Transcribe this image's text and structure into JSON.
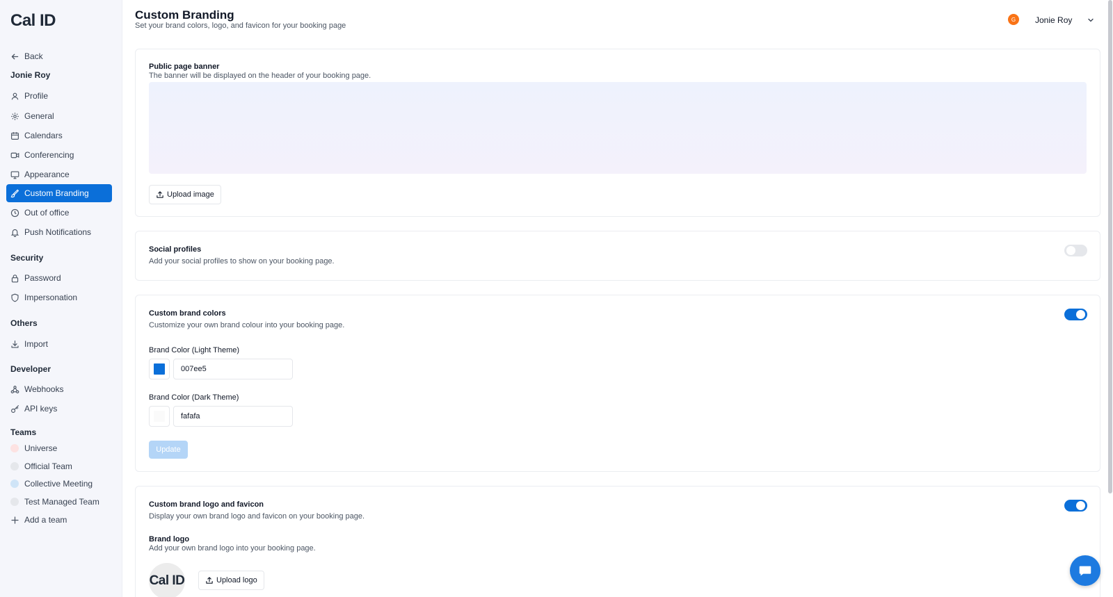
{
  "app": {
    "logo": "Cal ID"
  },
  "sidebar": {
    "back_label": "Back",
    "user_name": "Jonie Roy",
    "account_items": [
      {
        "label": "Profile",
        "icon": "user-icon"
      },
      {
        "label": "General",
        "icon": "gear-icon"
      },
      {
        "label": "Calendars",
        "icon": "calendar-icon"
      },
      {
        "label": "Conferencing",
        "icon": "video-icon"
      },
      {
        "label": "Appearance",
        "icon": "monitor-icon"
      },
      {
        "label": "Custom Branding",
        "icon": "brush-icon",
        "active": true
      },
      {
        "label": "Out of office",
        "icon": "clock-icon"
      },
      {
        "label": "Push Notifications",
        "icon": "bell-icon"
      }
    ],
    "security_heading": "Security",
    "security_items": [
      {
        "label": "Password",
        "icon": "lock-icon"
      },
      {
        "label": "Impersonation",
        "icon": "shield-icon"
      }
    ],
    "others_heading": "Others",
    "others_items": [
      {
        "label": "Import",
        "icon": "download-icon"
      }
    ],
    "developer_heading": "Developer",
    "developer_items": [
      {
        "label": "Webhooks",
        "icon": "webhook-icon"
      },
      {
        "label": "API keys",
        "icon": "key-icon"
      }
    ],
    "teams_heading": "Teams",
    "teams_items": [
      {
        "label": "Universe"
      },
      {
        "label": "Official Team"
      },
      {
        "label": "Collective Meeting"
      },
      {
        "label": "Test Managed Team"
      }
    ],
    "add_team_label": "Add a team"
  },
  "header": {
    "title": "Custom Branding",
    "subtitle": "Set your brand colors, logo, and favicon for your booking page",
    "user_initial": "G",
    "user_name": "Jonie Roy"
  },
  "banner_card": {
    "title": "Public page banner",
    "description": "The banner will be displayed on the header of your booking page.",
    "upload_label": "Upload image"
  },
  "social_card": {
    "title": "Social profiles",
    "description": "Add your social profiles to show on your booking page.",
    "enabled": false
  },
  "colors_card": {
    "title": "Custom brand colors",
    "description": "Customize your own brand colour into your booking page.",
    "enabled": true,
    "light_label": "Brand Color (Light Theme)",
    "light_value": "007ee5",
    "light_swatch": "#0b6fd9",
    "dark_label": "Brand Color (Dark Theme)",
    "dark_value": "fafafa",
    "dark_swatch": "#fafafa",
    "update_label": "Update"
  },
  "logo_card": {
    "title": "Custom brand logo and favicon",
    "description": "Display your own brand logo and favicon on your booking page.",
    "enabled": true,
    "brand_logo_title": "Brand logo",
    "brand_logo_desc": "Add your own brand logo into your booking page.",
    "logo_preview_text": "Cal ID",
    "upload_logo_label": "Upload logo"
  },
  "colors": {
    "accent": "#0b6fd9",
    "avatar": "#f97316"
  }
}
